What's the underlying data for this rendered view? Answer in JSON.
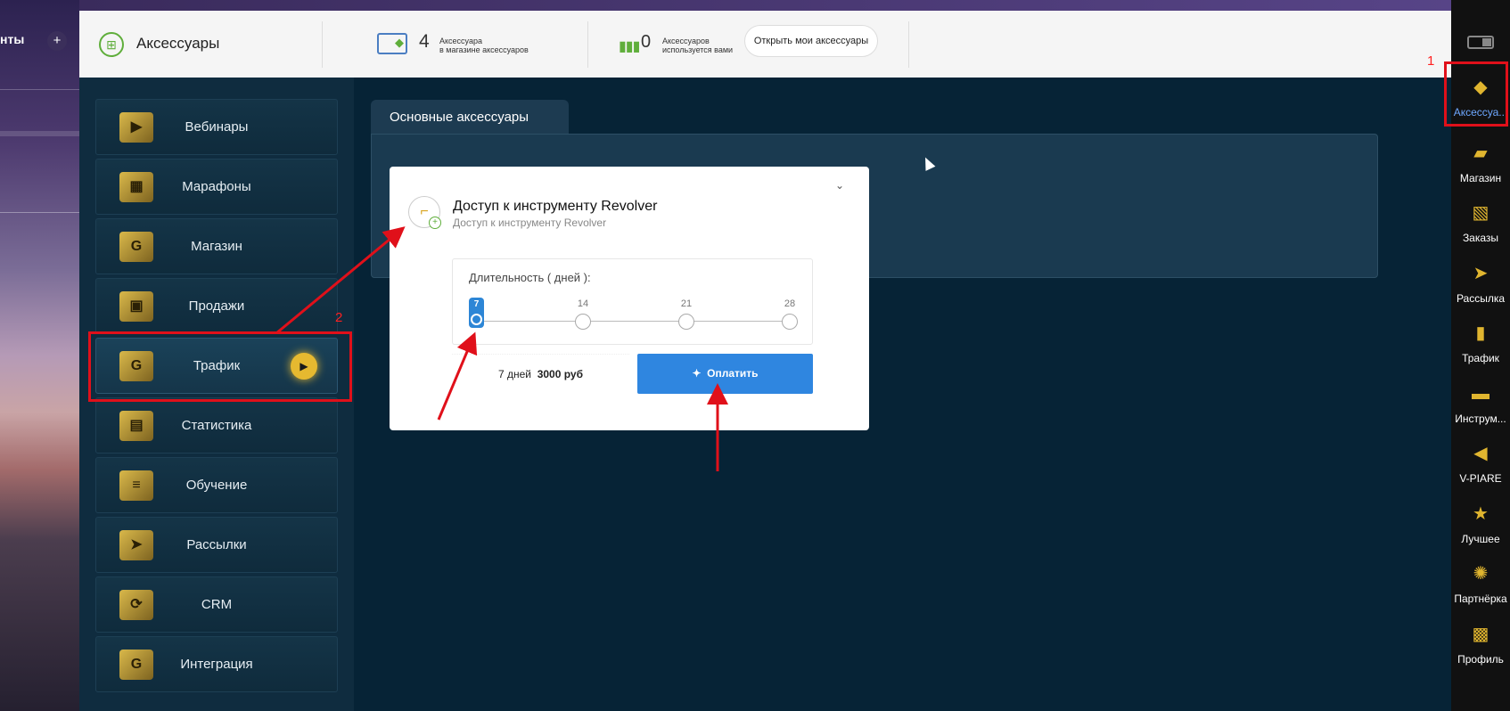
{
  "background_left": {
    "partial_text": "нты",
    "plus": "+"
  },
  "header": {
    "title": "Аксессуары",
    "store_count": "4",
    "store_label_line1": "Аксессуара",
    "store_label_line2": "в магазине аксессуаров",
    "used_count": "0",
    "used_label_line1": "Аксессуаров",
    "used_label_line2": "используется вами",
    "open_button": "Открыть мои аксессуары"
  },
  "sidebar": {
    "items": [
      {
        "label": "Вебинары"
      },
      {
        "label": "Марафоны"
      },
      {
        "label": "Магазин"
      },
      {
        "label": "Продажи"
      },
      {
        "label": "Трафик"
      },
      {
        "label": "Статистика"
      },
      {
        "label": "Обучение"
      },
      {
        "label": "Рассылки"
      },
      {
        "label": "CRM"
      },
      {
        "label": "Интеграция"
      }
    ]
  },
  "main": {
    "tab_label": "Основные аксессуары",
    "card": {
      "title": "Доступ к инструменту Revolver",
      "subtitle": "Доступ к инструменту Revolver",
      "duration_label": "Длительность ( дней ):",
      "ticks": [
        "7",
        "14",
        "21",
        "28"
      ],
      "selected_tick": "7",
      "price_days": "7 дней",
      "price_amount": "3000 руб",
      "pay_button": "Оплатить"
    }
  },
  "dock": {
    "items": [
      {
        "label": "Аксессуа..."
      },
      {
        "label": "Магазин"
      },
      {
        "label": "Заказы"
      },
      {
        "label": "Рассылка"
      },
      {
        "label": "Трафик"
      },
      {
        "label": "Инструм..."
      },
      {
        "label": "V-PIARE"
      },
      {
        "label": "Лучшее"
      },
      {
        "label": "Партнёрка"
      },
      {
        "label": "Профиль"
      }
    ]
  },
  "annotations": {
    "label_1": "1",
    "label_2": "2"
  },
  "colors": {
    "accent_green": "#5fae3b",
    "pay_blue": "#2f86e0",
    "annotation_red": "#e0101a",
    "gold": "#e6b930"
  },
  "icons": {
    "header": "accessories-logo-icon",
    "store": "monitor-icon",
    "used": "bars-icon",
    "card": "revolver-icon",
    "pay": "plus-diamond-icon"
  }
}
